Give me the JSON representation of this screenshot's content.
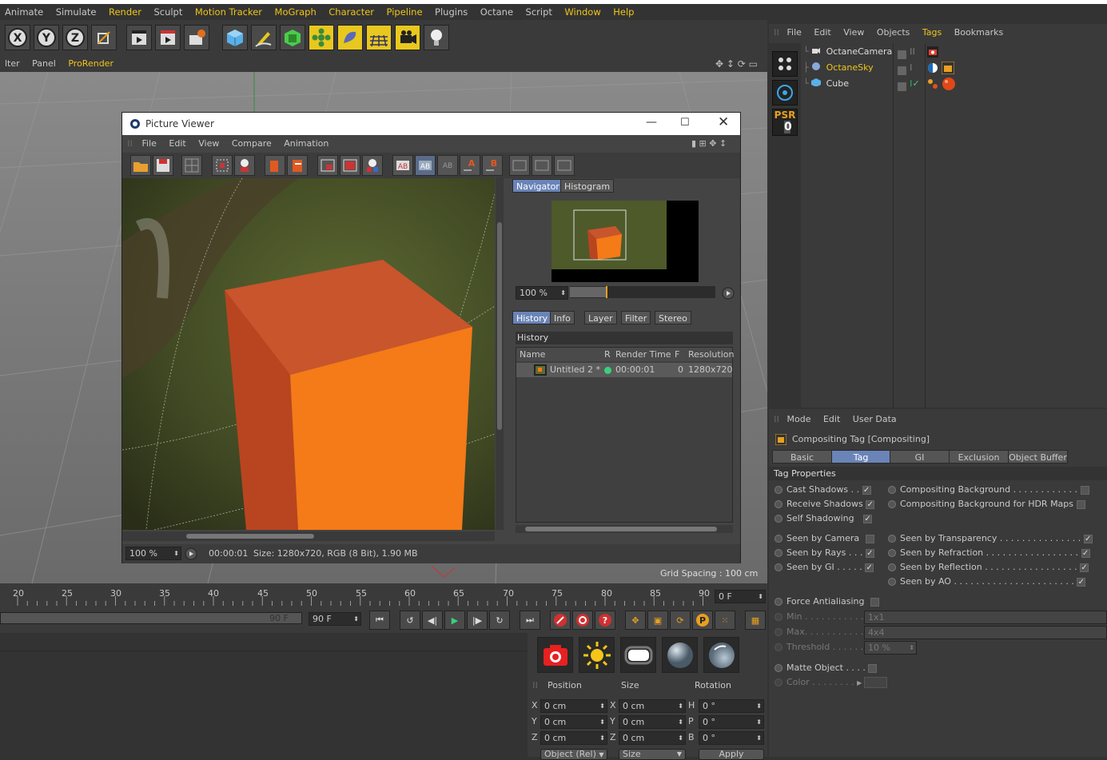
{
  "menubar": [
    "Animate",
    "Simulate",
    "Render",
    "Sculpt",
    "Motion Tracker",
    "MoGraph",
    "Character",
    "Pipeline",
    "Plugins",
    "Octane",
    "Script",
    "Window",
    "Help"
  ],
  "viewport_tabs": [
    "lter",
    "Panel",
    "ProRender"
  ],
  "viewport_status": "Grid Spacing : 100 cm",
  "picture_viewer": {
    "title": "Picture Viewer",
    "menu": [
      "File",
      "Edit",
      "View",
      "Compare",
      "Animation"
    ],
    "nav_tabs": [
      "Navigator",
      "Histogram"
    ],
    "zoom": "100 %",
    "bottom_tabs": [
      "History",
      "Info",
      "Layer",
      "Filter",
      "Stereo"
    ],
    "history_title": "History",
    "columns": [
      "Name",
      "R",
      "Render Time",
      "F",
      "Resolution"
    ],
    "rows": [
      {
        "name": "Untitled 2 *",
        "time": "00:00:01",
        "f": "0",
        "res": "1280x720"
      }
    ],
    "status_zoom": "100 %",
    "status_time": "00:00:01",
    "status_size": "Size: 1280x720, RGB (8 Bit), 1.90 MB"
  },
  "object_manager": {
    "menu": [
      "File",
      "Edit",
      "View",
      "Objects",
      "Tags",
      "Bookmarks"
    ],
    "objects": [
      "OctaneCamera",
      "OctaneSky",
      "Cube"
    ],
    "psr_label": "PSR",
    "psr_value": "0"
  },
  "attributes": {
    "menu": [
      "Mode",
      "Edit",
      "User Data"
    ],
    "title": "Compositing Tag [Compositing]",
    "tabs": [
      "Basic",
      "Tag",
      "GI",
      "Exclusion",
      "Object Buffer"
    ],
    "section": "Tag Properties",
    "left": [
      {
        "label": "Cast Shadows . .",
        "checked": true
      },
      {
        "label": "Receive Shadows",
        "checked": true
      },
      {
        "label": "Self Shadowing",
        "checked": true
      },
      {
        "label": "Seen by Camera",
        "checked": false
      },
      {
        "label": "Seen by Rays . . .",
        "checked": true
      },
      {
        "label": "Seen by GI . . . . .",
        "checked": true
      }
    ],
    "right": [
      {
        "label": "Compositing Background . . . . . . . . . . . .",
        "checked": false
      },
      {
        "label": "Compositing Background for HDR Maps",
        "checked": false
      },
      {
        "label": "Seen by Transparency . . . . . . . . . . . . . . .",
        "checked": true
      },
      {
        "label": "Seen by Refraction . . . . . . . . . . . . . . . . .",
        "checked": true
      },
      {
        "label": "Seen by Reflection . . . . . . . . . . . . . . . . .",
        "checked": true
      },
      {
        "label": "Seen by AO . . . . . . . . . . . . . . . . . . . . . .",
        "checked": true
      }
    ],
    "force_aa": "Force Antialiasing",
    "min_label": "Min . . . . . . . . . . .",
    "min_value": "1x1",
    "max_label": "Max. . . . . . . . . . .",
    "max_value": "4x4",
    "threshold_label": "Threshold . . . . . .",
    "threshold_value": "10 %",
    "matte": "Matte Object . . . .",
    "color_label": "Color . . . . . . . ."
  },
  "timeline": {
    "ticks": [
      "20",
      "25",
      "30",
      "35",
      "40",
      "45",
      "50",
      "55",
      "60",
      "65",
      "70",
      "75",
      "80",
      "85",
      "90"
    ],
    "frame": "0 F",
    "end1": "90 F",
    "end2": "90 F"
  },
  "coords": {
    "headers": [
      "Position",
      "Size",
      "Rotation"
    ],
    "rows": [
      {
        "a": "X",
        "av": "0 cm",
        "b": "X",
        "bv": "0 cm",
        "c": "H",
        "cv": "0 °"
      },
      {
        "a": "Y",
        "av": "0 cm",
        "b": "Y",
        "bv": "0 cm",
        "c": "P",
        "cv": "0 °"
      },
      {
        "a": "Z",
        "av": "0 cm",
        "b": "Z",
        "bv": "0 cm",
        "c": "B",
        "cv": "0 °"
      }
    ],
    "buttons": [
      "Object (Rel)",
      "Size",
      "Apply"
    ]
  }
}
